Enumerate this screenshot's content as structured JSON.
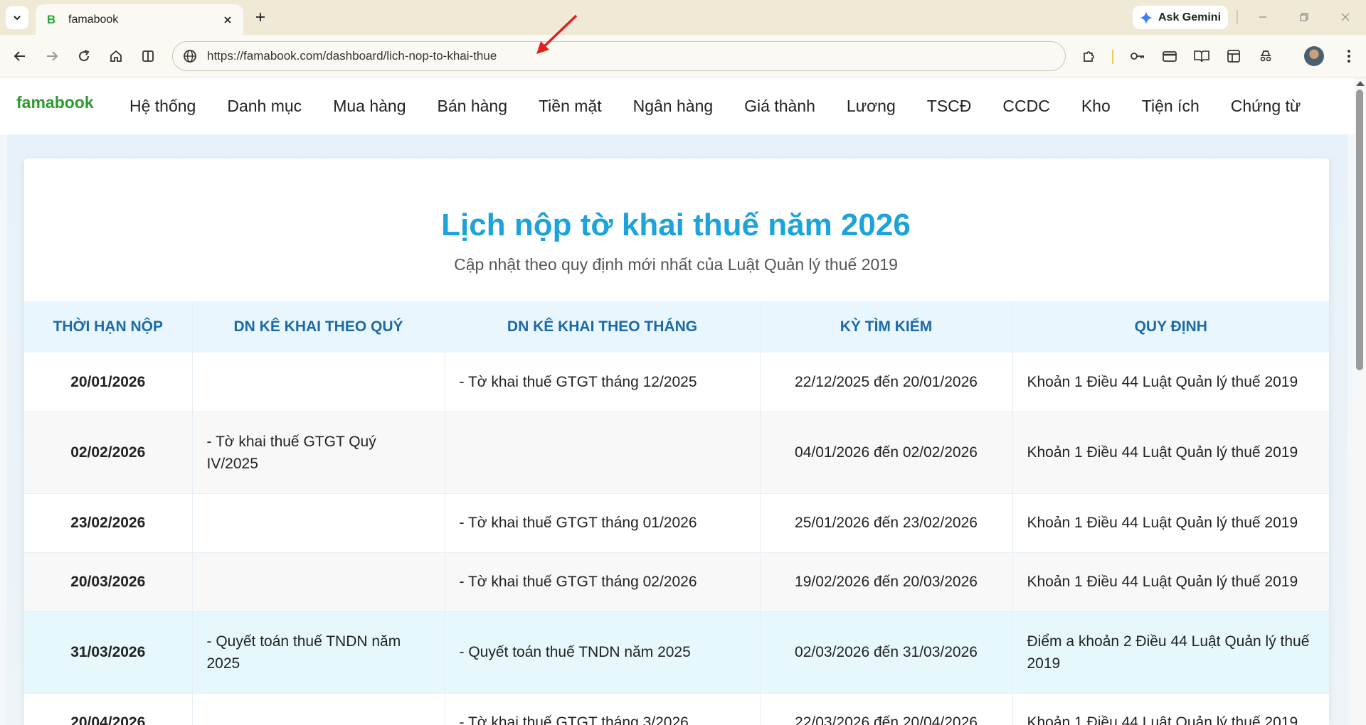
{
  "browser": {
    "tab_title": "famabook",
    "favicon_letter": "B",
    "ask_gemini_label": "Ask Gemini",
    "url": "https://famabook.com/dashboard/lich-nop-to-khai-thue"
  },
  "site": {
    "brand": "famabook",
    "menu": [
      "Hệ thống",
      "Danh mục",
      "Mua hàng",
      "Bán hàng",
      "Tiền mặt",
      "Ngân hàng",
      "Giá thành",
      "Lương",
      "TSCĐ",
      "CCDC",
      "Kho",
      "Tiện ích",
      "Chứng từ"
    ]
  },
  "page": {
    "title": "Lịch nộp tờ khai thuế năm 2026",
    "subtitle": "Cập nhật theo quy định mới nhất của Luật Quản lý thuế 2019"
  },
  "table": {
    "headers": [
      "THỜI HẠN NỘP",
      "DN KÊ KHAI THEO QUÝ",
      "DN KÊ KHAI THEO THÁNG",
      "KỲ TÌM KIẾM",
      "QUY ĐỊNH"
    ],
    "rows": [
      {
        "deadline": "20/01/2026",
        "quarterly": "",
        "monthly": "- Tờ khai thuế GTGT tháng 12/2025",
        "period": "22/12/2025 đến 20/01/2026",
        "rule": "Khoản 1 Điều 44 Luật Quản lý thuế 2019"
      },
      {
        "deadline": "02/02/2026",
        "quarterly": "- Tờ khai thuế GTGT Quý IV/2025",
        "monthly": "",
        "period": "04/01/2026 đến 02/02/2026",
        "rule": "Khoản 1 Điều 44 Luật Quản lý thuế 2019"
      },
      {
        "deadline": "23/02/2026",
        "quarterly": "",
        "monthly": "- Tờ khai thuế GTGT tháng 01/2026",
        "period": "25/01/2026 đến 23/02/2026",
        "rule": "Khoản 1 Điều 44 Luật Quản lý thuế 2019"
      },
      {
        "deadline": "20/03/2026",
        "quarterly": "",
        "monthly": "- Tờ khai thuế GTGT tháng 02/2026",
        "period": "19/02/2026 đến 20/03/2026",
        "rule": "Khoản 1 Điều 44 Luật Quản lý thuế 2019"
      },
      {
        "deadline": "31/03/2026",
        "quarterly": "- Quyết toán thuế TNDN năm 2025",
        "monthly": "- Quyết toán thuế TNDN năm 2025",
        "period": "02/03/2026 đến 31/03/2026",
        "rule": "Điểm a khoản 2 Điều 44 Luật Quản lý thuế 2019"
      },
      {
        "deadline": "20/04/2026",
        "quarterly": "",
        "monthly": "- Tờ khai thuế GTGT tháng 3/2026",
        "period": "22/03/2026 đến 20/04/2026",
        "rule": "Khoản 1 Điều 44 Luật Quản lý thuế 2019"
      }
    ]
  },
  "colors": {
    "title": "#1ca3dc",
    "header_text": "#1a6aa8",
    "deadline": "#b3163c",
    "brand": "#2e9a2e",
    "annotation_arrow": "#e02020"
  }
}
